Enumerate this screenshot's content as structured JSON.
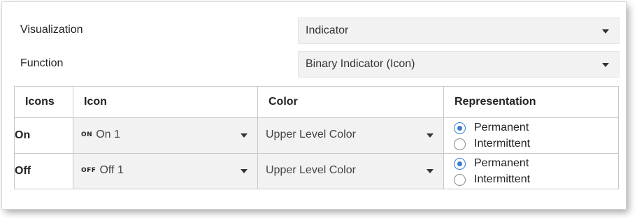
{
  "fields": {
    "visualization": {
      "label": "Visualization",
      "value": "Indicator"
    },
    "function": {
      "label": "Function",
      "value": "Binary Indicator (Icon)"
    }
  },
  "table": {
    "headers": [
      "Icons",
      "Icon",
      "Color",
      "Representation"
    ],
    "rows": [
      {
        "name": "On",
        "icon_glyph": "ON",
        "icon_value": "On 1",
        "color": "Upper Level Color",
        "options": [
          "Permanent",
          "Intermittent"
        ],
        "selected": "Permanent"
      },
      {
        "name": "Off",
        "icon_glyph": "OFF",
        "icon_value": "Off 1",
        "color": "Upper Level Color",
        "options": [
          "Permanent",
          "Intermittent"
        ],
        "selected": "Permanent"
      }
    ]
  },
  "colors": {
    "accent": "#3a7bd5",
    "dropdown_bg": "#f2f2f2",
    "border": "#c8c8c8"
  }
}
